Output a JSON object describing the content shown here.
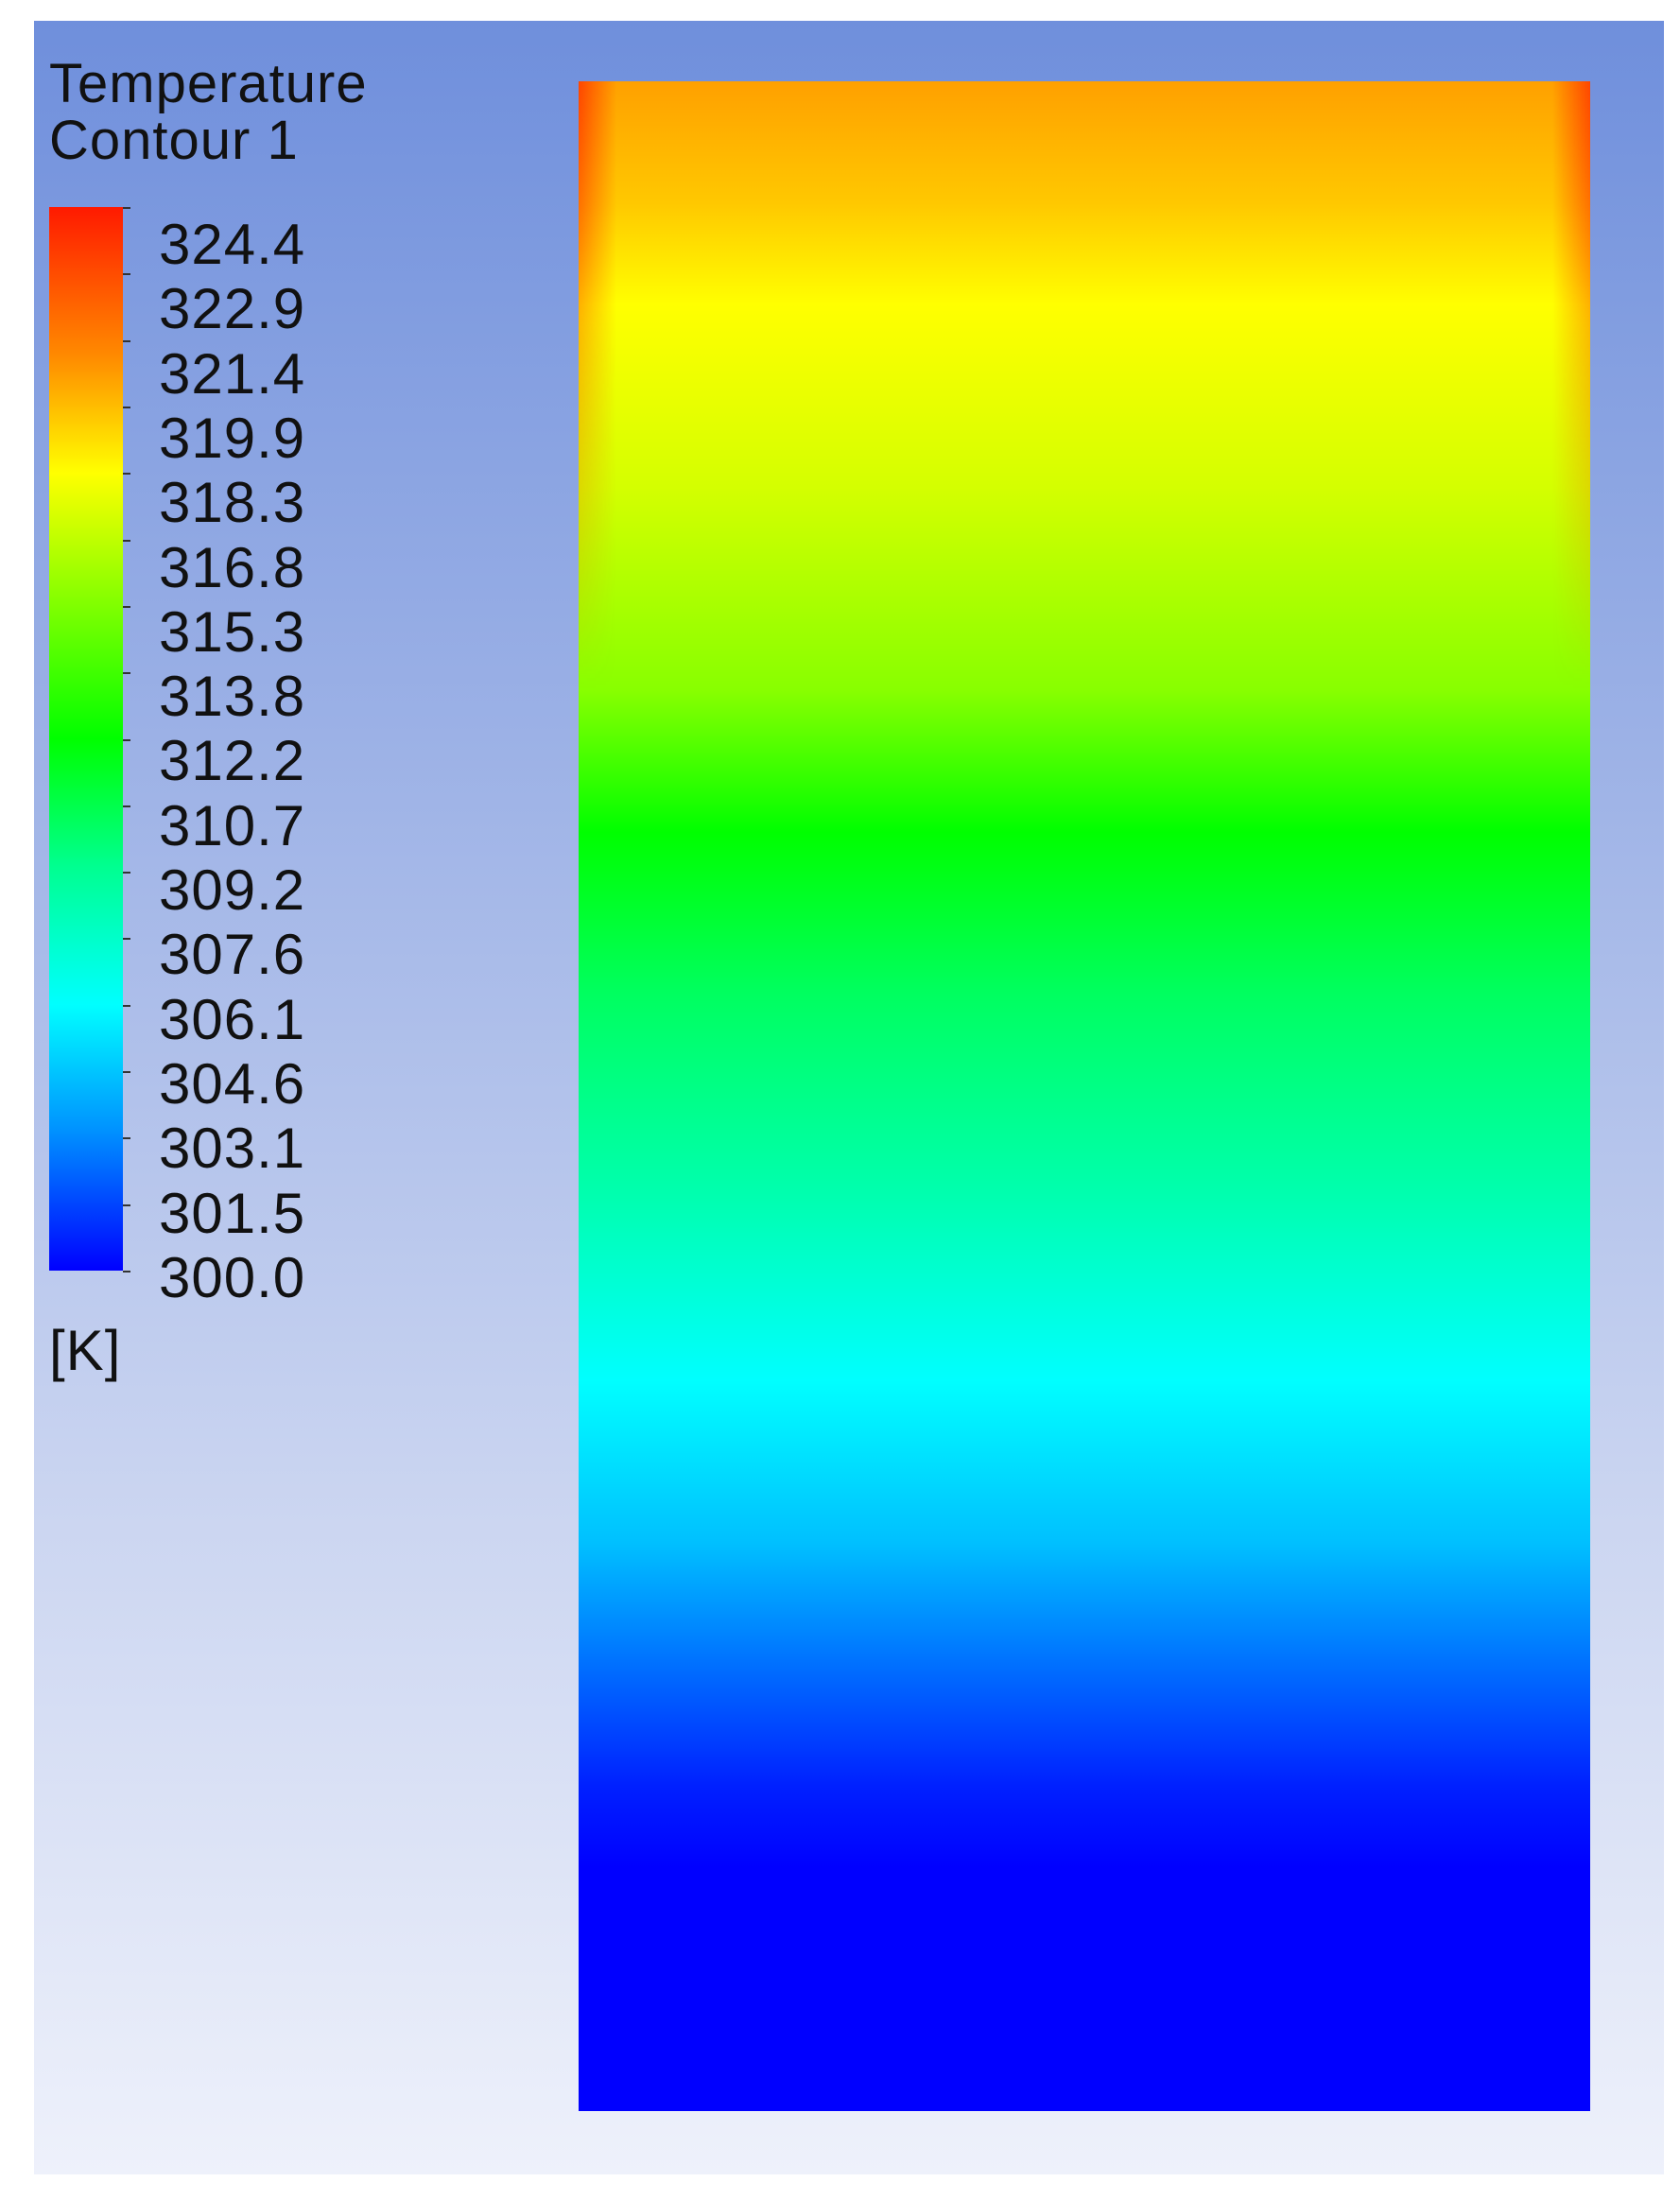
{
  "chart_data": {
    "type": "heatmap",
    "title": "Temperature",
    "subtitle": "Contour 1",
    "units": "[K]",
    "colorbar": {
      "min": 300.0,
      "max": 324.4,
      "colormap": "rainbow",
      "tick_labels": [
        "324.4",
        "322.9",
        "321.4",
        "319.9",
        "318.3",
        "316.8",
        "315.3",
        "313.8",
        "312.2",
        "310.7",
        "309.2",
        "307.6",
        "306.1",
        "304.6",
        "303.1",
        "301.5",
        "300.0"
      ]
    },
    "field_description_profile": {
      "direction": "vertical (top hot, bottom cold)",
      "top_value_K": 322.5,
      "walls_top_value_K": 324.4,
      "bottom_value_K": 300.0
    }
  }
}
